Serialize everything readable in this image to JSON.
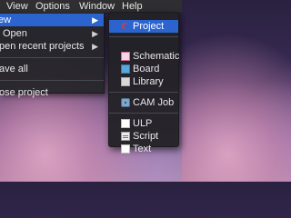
{
  "menubar": {
    "items": [
      "",
      "View",
      "Options",
      "Window",
      "Help"
    ]
  },
  "file_menu": {
    "items": [
      {
        "label": "New",
        "submenu": true,
        "highlighted": true
      },
      {
        "label": "Open",
        "submenu": true
      },
      {
        "label": "Open recent projects",
        "submenu": true
      },
      {
        "label": "Save all"
      },
      {
        "label": "Close project"
      }
    ],
    "visible_text": {
      "new": "ew",
      "open": "Open",
      "open_recent": "pen recent projects",
      "save_all": "ave all",
      "close_project": "ose project"
    }
  },
  "new_submenu": {
    "items": [
      {
        "label": "Project",
        "icon": "project-icon",
        "highlighted": true
      },
      {
        "label": "Schematic",
        "icon": "schematic-icon"
      },
      {
        "label": "Board",
        "icon": "board-icon"
      },
      {
        "label": "Library",
        "icon": "library-icon"
      },
      {
        "label": "CAM Job",
        "icon": "cam-job-icon"
      },
      {
        "label": "ULP",
        "icon": "ulp-icon"
      },
      {
        "label": "Script",
        "icon": "script-icon"
      },
      {
        "label": "Text",
        "icon": "text-icon"
      }
    ]
  },
  "colors": {
    "menubar": "#2f2f31",
    "highlight": "#2b64cf",
    "menu_bg": "#28262c"
  }
}
